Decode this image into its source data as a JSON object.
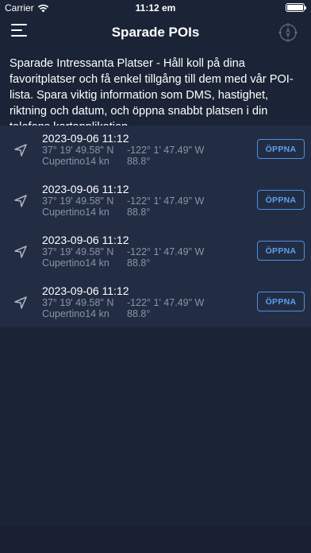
{
  "status_bar": {
    "carrier": "Carrier",
    "time": "11:12 em",
    "battery_level": 1.0
  },
  "nav": {
    "title": "Sparade POIs",
    "menu_icon": "hamburger-menu-icon",
    "compass_icon": "compass-icon"
  },
  "intro_text": "Sparade Intressanta Platser - Håll koll på dina favoritplatser och få enkel tillgång till dem med vår POI-lista. Spara viktig information som DMS, hastighet, riktning och datum, och öppna snabbt platsen i din telefons kartapplikation.",
  "pois": [
    {
      "date": "2023-09-06 11:12",
      "latitude": "37° 19' 49.58\" N",
      "longitude": "-122° 1' 47.49\" W",
      "place_speed": "Cupertino14 kn",
      "heading": "88.8°",
      "open_label": "ÖPPNA"
    },
    {
      "date": "2023-09-06 11:12",
      "latitude": "37° 19' 49.58\" N",
      "longitude": "-122° 1' 47.49\" W",
      "place_speed": "Cupertino14 kn",
      "heading": "88.8°",
      "open_label": "ÖPPNA"
    },
    {
      "date": "2023-09-06 11:12",
      "latitude": "37° 19' 49.58\" N",
      "longitude": "-122° 1' 47.49\" W",
      "place_speed": "Cupertino14 kn",
      "heading": "88.8°",
      "open_label": "ÖPPNA"
    },
    {
      "date": "2023-09-06 11:12",
      "latitude": "37° 19' 49.58\" N",
      "longitude": "-122° 1' 47.49\" W",
      "place_speed": "Cupertino14 kn",
      "heading": "88.8°",
      "open_label": "ÖPPNA"
    }
  ],
  "colors": {
    "background": "#1b2436",
    "list_background": "#222d44",
    "accent": "#4a90e2",
    "secondary_text": "#8b93a3"
  }
}
